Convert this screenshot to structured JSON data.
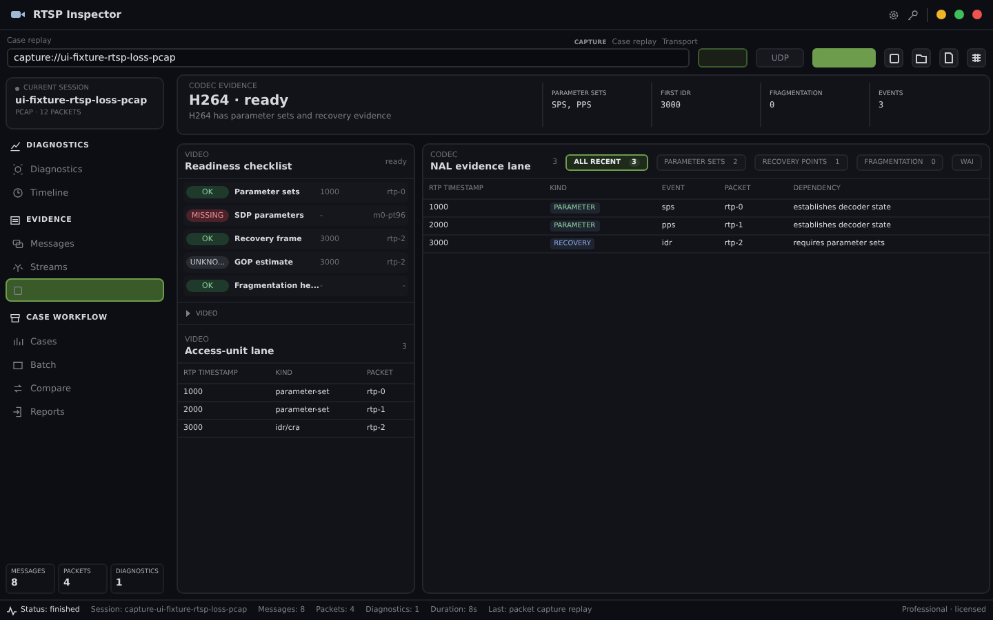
{
  "window": {
    "title": "RTSP Inspector"
  },
  "replay": {
    "label": "Case replay",
    "value": "capture://ui-fixture-rtsp-loss-pcap",
    "capture_label": "CAPTURE",
    "capture_value": "Case replay",
    "transport_label": "Transport",
    "transport_option": "UDP"
  },
  "session": {
    "heading": "CURRENT SESSION",
    "name": "ui-fixture-rtsp-loss-pcap",
    "meta": "PCAP · 12 PACKETS"
  },
  "sidebar": {
    "sections": [
      {
        "title": "DIAGNOSTICS",
        "items": [
          {
            "label": "Diagnostics",
            "selected": false
          },
          {
            "label": "Timeline",
            "selected": false
          }
        ]
      },
      {
        "title": "EVIDENCE",
        "items": [
          {
            "label": "Messages",
            "selected": false
          },
          {
            "label": "Streams",
            "selected": false
          },
          {
            "selected": true
          }
        ]
      },
      {
        "title": "CASE WORKFLOW",
        "items": [
          {
            "label": "Cases",
            "selected": false
          },
          {
            "label": "Batch",
            "selected": false
          },
          {
            "label": "Compare",
            "selected": false
          },
          {
            "label": "Reports",
            "selected": false
          }
        ]
      }
    ]
  },
  "counters": [
    {
      "label": "MESSAGES",
      "value": "8"
    },
    {
      "label": "PACKETS",
      "value": "4"
    },
    {
      "label": "DIAGNOSTICS",
      "value": "1"
    }
  ],
  "codec": {
    "eyebrow": "CODEC EVIDENCE",
    "title": "H264 · ready",
    "subtitle": "H264 has parameter sets and recovery evidence",
    "stats": [
      {
        "label": "PARAMETER SETS",
        "value": "SPS, PPS"
      },
      {
        "label": "FIRST IDR",
        "value": "3000"
      },
      {
        "label": "FRAGMENTATION",
        "value": "0"
      },
      {
        "label": "EVENTS",
        "value": "3"
      }
    ]
  },
  "checklist": {
    "eyebrow": "VIDEO",
    "title": "Readiness checklist",
    "state": "ready",
    "items": [
      {
        "status": "OK",
        "kind": "ok",
        "name": "Parameter sets",
        "timestamp": "1000",
        "packet": "rtp-0"
      },
      {
        "status": "MISSING",
        "kind": "missing",
        "name": "SDP parameters",
        "timestamp": "-",
        "packet": "m0-pt96"
      },
      {
        "status": "OK",
        "kind": "ok",
        "name": "Recovery frame",
        "timestamp": "3000",
        "packet": "rtp-2"
      },
      {
        "status": "UNKNO...",
        "kind": "unknown",
        "name": "GOP estimate",
        "timestamp": "3000",
        "packet": "rtp-2"
      },
      {
        "status": "OK",
        "kind": "ok",
        "name": "Fragmentation he...",
        "timestamp": "-",
        "packet": "-"
      }
    ]
  },
  "expander": {
    "label": "VIDEO",
    "expanded": false
  },
  "access_units": {
    "eyebrow": "VIDEO",
    "title": "Access-unit lane",
    "count": "3",
    "columns": [
      "RTP TIMESTAMP",
      "KIND",
      "PACKET"
    ],
    "rows": [
      [
        "1000",
        "parameter-set",
        "rtp-0"
      ],
      [
        "2000",
        "parameter-set",
        "rtp-1"
      ],
      [
        "3000",
        "idr/cra",
        "rtp-2"
      ]
    ]
  },
  "nal": {
    "eyebrow": "CODEC",
    "title": "NAL evidence lane",
    "count": "3",
    "filters": [
      {
        "label": "ALL RECENT",
        "count": "3",
        "selected": true
      },
      {
        "label": "PARAMETER SETS",
        "count": "2",
        "selected": false
      },
      {
        "label": "RECOVERY POINTS",
        "count": "1",
        "selected": false
      },
      {
        "label": "FRAGMENTATION",
        "count": "0",
        "selected": false
      },
      {
        "label": "WAI",
        "selected": false
      }
    ],
    "columns": [
      "RTP TIMESTAMP",
      "KIND",
      "EVENT",
      "PACKET",
      "DEPENDENCY"
    ],
    "rows": [
      {
        "timestamp": "1000",
        "kind": "PARAMETER",
        "color": "#8fd19e",
        "event": "sps",
        "packet": "rtp-0",
        "dependency": "establishes decoder state"
      },
      {
        "timestamp": "2000",
        "kind": "PARAMETER",
        "color": "#8fd19e",
        "event": "pps",
        "packet": "rtp-1",
        "dependency": "establishes decoder state"
      },
      {
        "timestamp": "3000",
        "kind": "RECOVERY",
        "color": "#8ea6e8",
        "event": "idr",
        "packet": "rtp-2",
        "dependency": "requires parameter sets"
      }
    ]
  },
  "status_bar": {
    "status": "Status: finished",
    "items": [
      "Session: capture-ui-fixture-rtsp-loss-pcap",
      "Messages: 8",
      "Packets: 4",
      "Diagnostics: 1",
      "Duration: 8s",
      "Last: packet capture replay"
    ],
    "license": "Professional · licensed"
  }
}
